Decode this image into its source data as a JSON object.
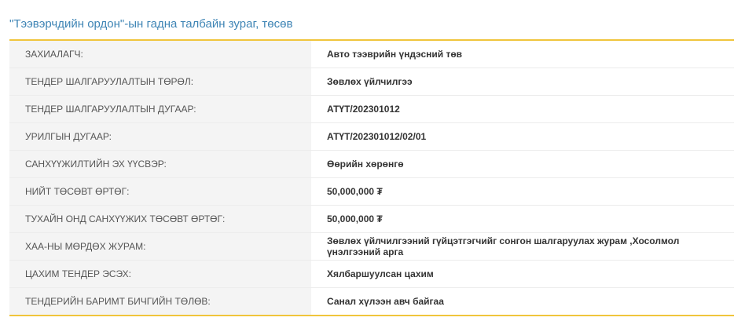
{
  "title": "\"Тээвэрчдийн ордон\"-ын гадна талбайн зураг, төсөв",
  "rows": [
    {
      "label": "ЗАХИАЛАГЧ:",
      "value": "Авто тээврийн үндэсний төв"
    },
    {
      "label": "ТЕНДЕР ШАЛГАРУУЛАЛТЫН ТӨРӨЛ:",
      "value": "Зөвлөх үйлчилгээ"
    },
    {
      "label": "ТЕНДЕР ШАЛГАРУУЛАЛТЫН ДУГААР:",
      "value": "АТҮТ/202301012"
    },
    {
      "label": "УРИЛГЫН ДУГААР:",
      "value": "АТҮТ/202301012/02/01"
    },
    {
      "label": "САНХҮҮЖИЛТИЙН ЭХ ҮҮСВЭР:",
      "value": "Өөрийн хөрөнгө"
    },
    {
      "label": "НИЙТ ТӨСӨВТ ӨРТӨГ:",
      "value": "50,000,000 ₮"
    },
    {
      "label": "ТУХАЙН ОНД САНХҮҮЖИХ ТӨСӨВТ ӨРТӨГ:",
      "value": "50,000,000 ₮"
    },
    {
      "label": "ХАА-НЫ МӨРДӨХ ЖУРАМ:",
      "value": "Зөвлөх үйлчилгээний гүйцэтгэгчийг сонгон шалгаруулах журам ,Хосолмол үнэлгээний арга"
    },
    {
      "label": "ЦАХИМ ТЕНДЕР ЭСЭХ:",
      "value": "Хялбаршуулсан цахим"
    },
    {
      "label": "ТЕНДЕРИЙН БАРИМТ БИЧГИЙН ТӨЛӨВ:",
      "value": "Санал хүлээн авч байгаа"
    }
  ]
}
